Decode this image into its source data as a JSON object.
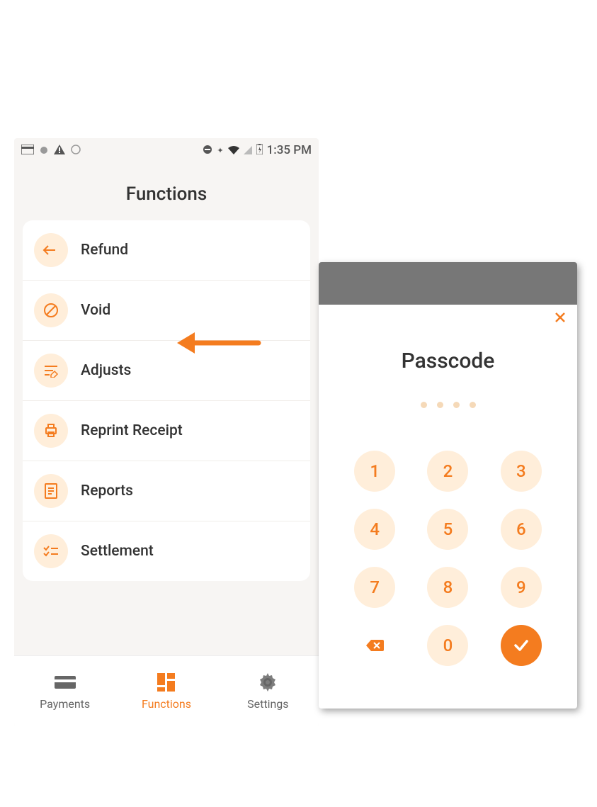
{
  "statusbar": {
    "time": "1:35 PM"
  },
  "screen": {
    "title": "Functions"
  },
  "functions": [
    {
      "label": "Refund",
      "icon": "return"
    },
    {
      "label": "Void",
      "icon": "prohibit"
    },
    {
      "label": "Adjusts",
      "icon": "edit-lines"
    },
    {
      "label": "Reprint Receipt",
      "icon": "printer"
    },
    {
      "label": "Reports",
      "icon": "document"
    },
    {
      "label": "Settlement",
      "icon": "checklist"
    }
  ],
  "bottomnav": {
    "payments": "Payments",
    "functions": "Functions",
    "settings": "Settings"
  },
  "passcode": {
    "title": "Passcode",
    "keys": [
      "1",
      "2",
      "3",
      "4",
      "5",
      "6",
      "7",
      "8",
      "9",
      "",
      "0",
      ""
    ]
  },
  "colors": {
    "accent": "#f47c1f",
    "accentLight": "#ffeeda"
  }
}
